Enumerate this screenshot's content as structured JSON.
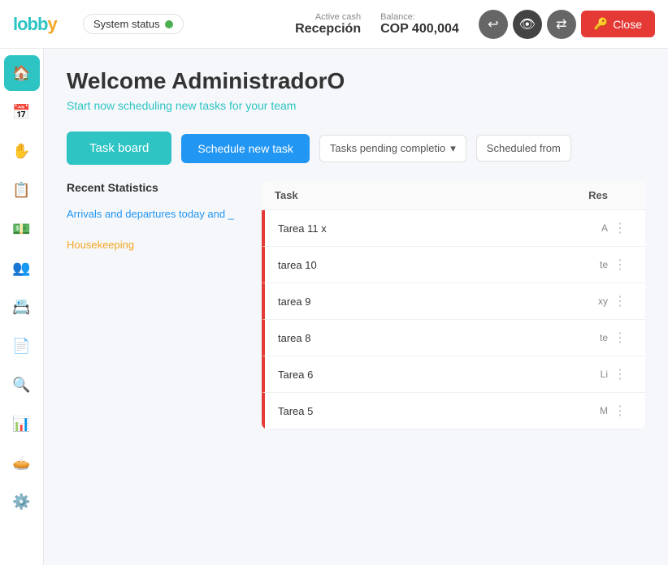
{
  "header": {
    "logo": "lobby",
    "system_status_label": "System status",
    "active_cash_label": "Active cash",
    "active_cash_value": "Recepción",
    "balance_label": "Balance:",
    "balance_value": "COP 400,004",
    "icon_history": "↩",
    "icon_eye": "👁",
    "icon_transfer": "⇄",
    "close_label": "Close"
  },
  "sidebar": {
    "items": [
      {
        "icon": "🏠",
        "name": "home",
        "active": true
      },
      {
        "icon": "📅",
        "name": "calendar",
        "active": false
      },
      {
        "icon": "✋",
        "name": "tasks",
        "active": false
      },
      {
        "icon": "📋",
        "name": "list",
        "active": false
      },
      {
        "icon": "💵",
        "name": "cash",
        "active": false
      },
      {
        "icon": "👥",
        "name": "guests",
        "active": false
      },
      {
        "icon": "📇",
        "name": "contacts",
        "active": false
      },
      {
        "icon": "📄",
        "name": "reports",
        "active": false
      },
      {
        "icon": "🔍",
        "name": "search",
        "active": false
      },
      {
        "icon": "📊",
        "name": "analytics",
        "active": false
      },
      {
        "icon": "🥧",
        "name": "pie",
        "active": false
      },
      {
        "icon": "⚙️",
        "name": "settings",
        "active": false
      }
    ]
  },
  "main": {
    "welcome_title": "Welcome AdministradorO",
    "welcome_sub": "Start now scheduling new tasks for your team",
    "task_board_label": "Task board",
    "schedule_new_label": "Schedule new task",
    "tasks_pending_label": "Tasks pending completio",
    "scheduled_from_label": "Scheduled from",
    "recent_stats_title": "Recent Statistics",
    "stats": [
      {
        "title": "Arrivals and departures today and _",
        "color": "blue"
      },
      {
        "title": "Housekeeping",
        "color": "orange"
      }
    ],
    "table": {
      "col_task": "Task",
      "col_res": "Res",
      "rows": [
        {
          "name": "Tarea 11 x",
          "assignee": "A"
        },
        {
          "name": "tarea 10",
          "assignee": "te"
        },
        {
          "name": "tarea 9",
          "assignee": "xy"
        },
        {
          "name": "tarea 8",
          "assignee": "te"
        },
        {
          "name": "Tarea 6",
          "assignee": "Li"
        },
        {
          "name": "Tarea 5",
          "assignee": "M"
        }
      ]
    }
  }
}
